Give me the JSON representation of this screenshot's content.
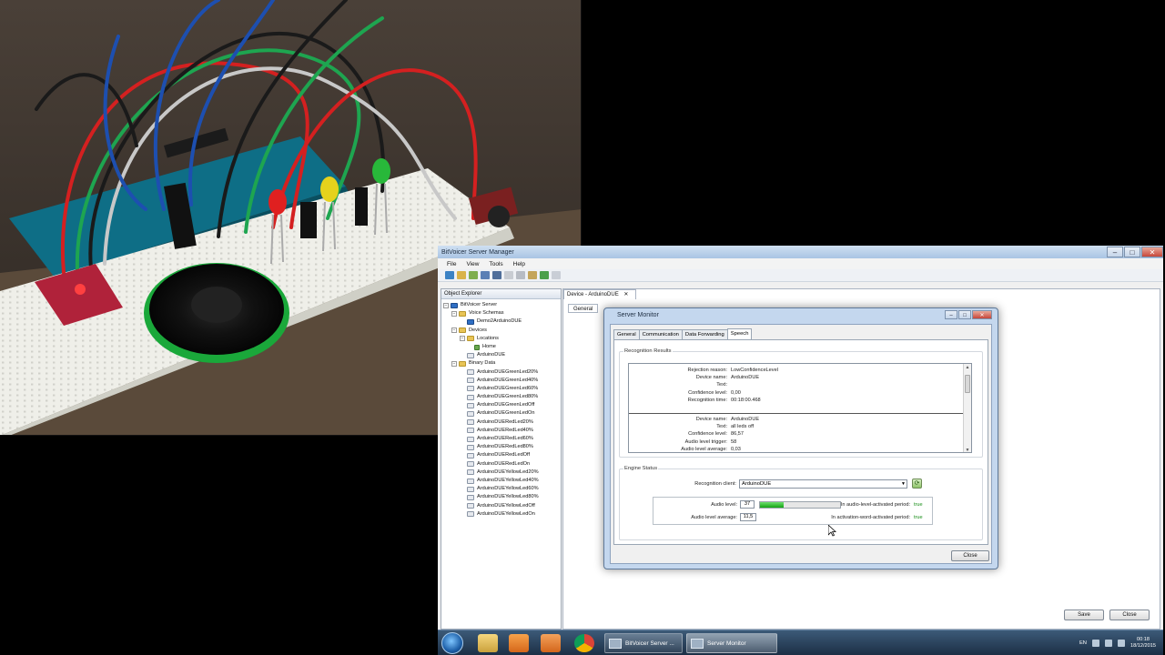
{
  "app": {
    "title": "BitVoicer Server Manager",
    "menu": [
      "File",
      "View",
      "Tools",
      "Help"
    ],
    "explorer": {
      "title": "Object Explorer",
      "root": "BitVoicer Server",
      "voice_schemas": "Voice Schemas",
      "schema_item": "Demo2ArduinoDUE",
      "devices": "Devices",
      "locations": "Locations",
      "location_item": "Home",
      "device_item": "ArduinoDUE",
      "binary_data": "Binary Data",
      "binary_items": [
        "ArduinoDUEGreenLed20%",
        "ArduinoDUEGreenLed40%",
        "ArduinoDUEGreenLed60%",
        "ArduinoDUEGreenLed80%",
        "ArduinoDUEGreenLedOff",
        "ArduinoDUEGreenLedOn",
        "ArduinoDUERedLed20%",
        "ArduinoDUERedLed40%",
        "ArduinoDUERedLed60%",
        "ArduinoDUERedLed80%",
        "ArduinoDUERedLedOff",
        "ArduinoDUERedLedOn",
        "ArduinoDUEYellowLed20%",
        "ArduinoDUEYellowLed40%",
        "ArduinoDUEYellowLed60%",
        "ArduinoDUEYellowLed80%",
        "ArduinoDUEYellowLedOff",
        "ArduinoDUEYellowLedOn"
      ]
    },
    "doc_tab": "Device - ArduinoDUE",
    "doc_subtab": "General",
    "save": "Save",
    "close": "Close"
  },
  "monitor": {
    "title": "Server Monitor",
    "tabs": [
      "General",
      "Communication",
      "Data Forwarding",
      "Speech"
    ],
    "active_tab": "Speech",
    "results_label": "Recognition Results",
    "result1": [
      {
        "k": "Rejection reason:",
        "v": "LowConfidenceLevel"
      },
      {
        "k": "Device name:",
        "v": "ArduinoDUE"
      },
      {
        "k": "Text:",
        "v": ""
      },
      {
        "k": "Confidence level:",
        "v": "0,00"
      },
      {
        "k": "Recognition time:",
        "v": "00:18:00.468"
      }
    ],
    "result2": [
      {
        "k": "Device name:",
        "v": "ArduinoDUE"
      },
      {
        "k": "Text:",
        "v": "all leds off"
      },
      {
        "k": "Confidence level:",
        "v": "86,57"
      },
      {
        "k": "Audio level trigger:",
        "v": "58"
      },
      {
        "k": "Audio level average:",
        "v": "0,03"
      }
    ],
    "engine_label": "Engine Status",
    "client_label": "Recognition client:",
    "client_value": "ArduinoDUE",
    "audio_level_label": "Audio level:",
    "audio_level": "37",
    "audio_level_fraction": 0.3,
    "audio_avg_label": "Audio level average:",
    "audio_avg": "11,5",
    "period1_label": "In audio-level-activated period:",
    "period1_value": "true",
    "period2_label": "In activation-word-activated period:",
    "period2_value": "true",
    "close": "Close"
  },
  "taskbar": {
    "task1": "BitVoicer Server ...",
    "task2": "Server Monitor",
    "lang": "EN",
    "time": "00:18",
    "date": "18/12/2015"
  },
  "colors": {
    "accent": "#2f6fc4",
    "ok_green": "#1a8f1a",
    "led_red": "#e02020",
    "led_yellow": "#e6d21c",
    "led_green": "#28b83a"
  }
}
